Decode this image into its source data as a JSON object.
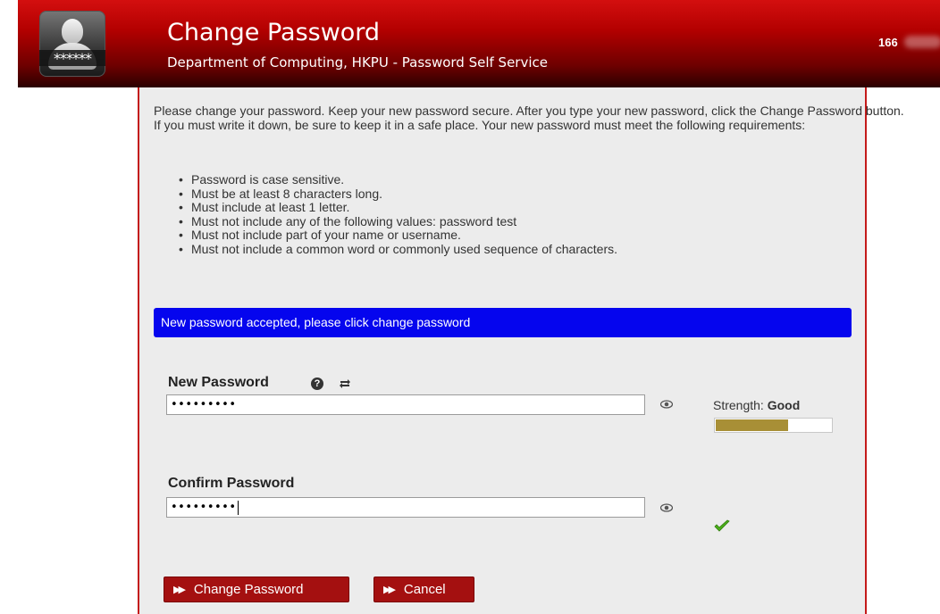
{
  "header": {
    "title": "Change Password",
    "subtitle": "Department of Computing, HKPU - Password Self Service",
    "user_id": "166",
    "avatar_mask": "******",
    "colors": {
      "header_red": "#b20000",
      "header_dark": "#2a0000"
    }
  },
  "intro": {
    "text": "Please change your password. Keep your new password secure. After you type your new password, click the Change Password button. If you must write it down, be sure to keep it in a safe place. Your new password must meet the following requirements:",
    "requirements": [
      "Password is case sensitive.",
      "Must be at least 8 characters long.",
      "Must include at least 1 letter.",
      "Must not include any of the following values: password test",
      "Must not include part of your name or username.",
      "Must not include a common word or commonly used sequence of characters."
    ]
  },
  "notice": {
    "text": "New password accepted, please click change password",
    "color": "#0505ee"
  },
  "new_password": {
    "label": "New Password",
    "help_icon": "question-circle-icon",
    "generate_icon": "refresh-icon",
    "value": "•••••••••",
    "show_icon": "eye-icon"
  },
  "strength": {
    "label": "Strength:",
    "level": "Good",
    "fraction": 0.62,
    "color": "#a88f36"
  },
  "confirm_password": {
    "label": "Confirm Password",
    "value": "•••••••••",
    "show_icon": "eye-icon",
    "match_icon": "checkmark-icon",
    "match_color": "#4caf1a"
  },
  "buttons": {
    "change_password": "Change Password",
    "cancel": "Cancel",
    "color": "#a41010"
  }
}
